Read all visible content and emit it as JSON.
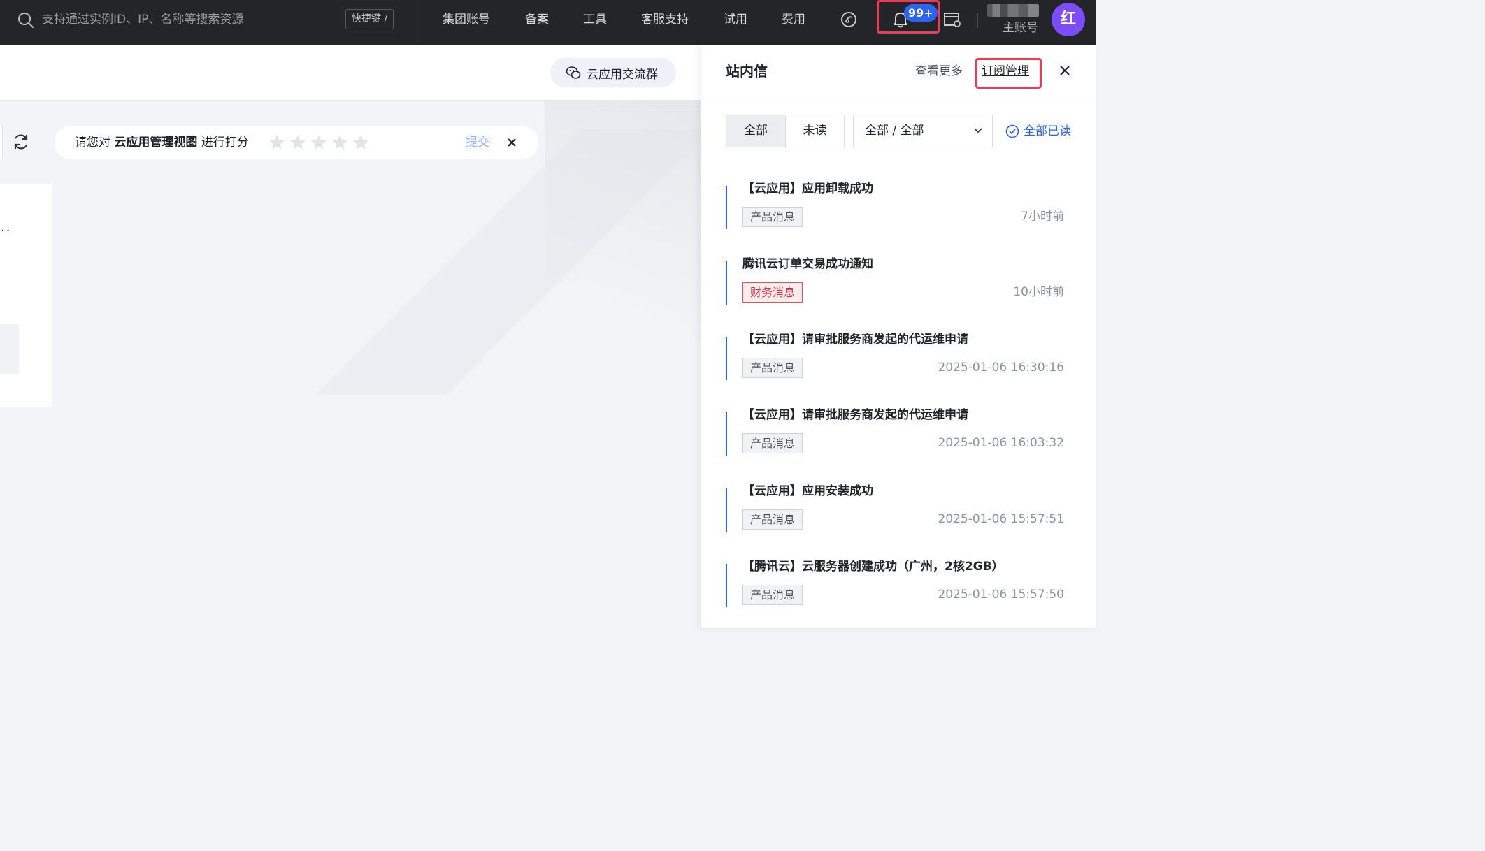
{
  "topbar": {
    "search_placeholder": "支持通过实例ID、IP、名称等搜索资源",
    "shortcut_label": "快捷键 /",
    "nav": [
      "集团账号",
      "备案",
      "工具",
      "客服支持",
      "试用",
      "费用"
    ],
    "notification_badge": "99+",
    "account_label": "主账号",
    "avatar_initial": "红",
    "avatar_color": "#7c4dff"
  },
  "main": {
    "community_button": "云应用交流群",
    "rating": {
      "prefix": "请您对",
      "subject": "云应用管理视图",
      "suffix": "进行打分",
      "stars": 5,
      "submit_label": "提交"
    }
  },
  "drawer": {
    "title": "站内信",
    "more_label": "查看更多",
    "subscription_label": "订阅管理",
    "filter_tabs": [
      "全部",
      "未读"
    ],
    "filter_select_value": "全部 / 全部",
    "mark_all_label": "全部已读",
    "messages": [
      {
        "title": "【云应用】应用卸载成功",
        "tag": "产品消息",
        "time": "7小时前"
      },
      {
        "title": "腾讯云订单交易成功通知",
        "tag": "财务消息",
        "time": "10小时前"
      },
      {
        "title": "【云应用】请审批服务商发起的代运维申请",
        "tag": "产品消息",
        "time": "2025-01-06 16:30:16"
      },
      {
        "title": "【云应用】请审批服务商发起的代运维申请",
        "tag": "产品消息",
        "time": "2025-01-06 16:03:32"
      },
      {
        "title": "【云应用】应用安装成功",
        "tag": "产品消息",
        "time": "2025-01-06 15:57:51"
      },
      {
        "title": "【腾讯云】云服务器创建成功（广州，2核2GB）",
        "tag": "产品消息",
        "time": "2025-01-06 15:57:50"
      }
    ]
  },
  "colors": {
    "accent": "#2b63f6",
    "highlight_border": "#ee3a55",
    "finance_tag": "#d6313f"
  }
}
